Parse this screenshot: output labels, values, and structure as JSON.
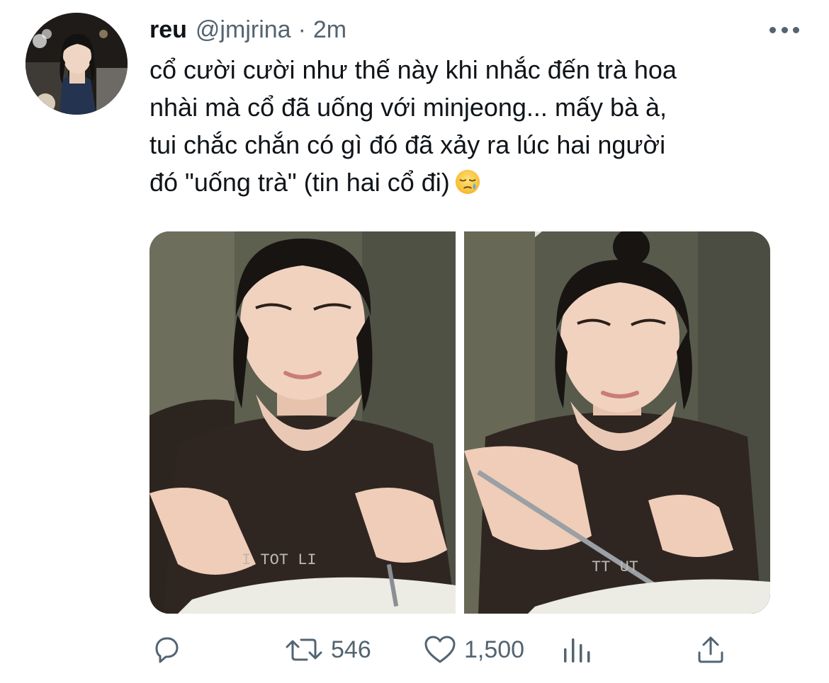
{
  "tweet": {
    "display_name": "reu",
    "handle": "@jmjrina",
    "separator": "·",
    "time": "2m",
    "text_lines": [
      "cổ cười cười như thế này khi nhắc đến trà hoa",
      "nhài mà cổ đã uống với minjeong... mấy bà à,",
      "tui chắc chắn có gì đó đã xảy ra lúc hai người",
      "đó \"uống trà\" (tin hai cổ đi)"
    ],
    "emoji": "sleepy-face-emoji"
  },
  "actions": {
    "reply_icon": "reply-icon",
    "retweet_icon": "retweet-icon",
    "retweet_count": "546",
    "like_icon": "heart-icon",
    "like_count": "1,500",
    "stats_icon": "analytics-icon",
    "share_icon": "share-icon"
  },
  "colors": {
    "text_primary": "#0f1419",
    "text_secondary": "#536471",
    "background": "#ffffff"
  }
}
